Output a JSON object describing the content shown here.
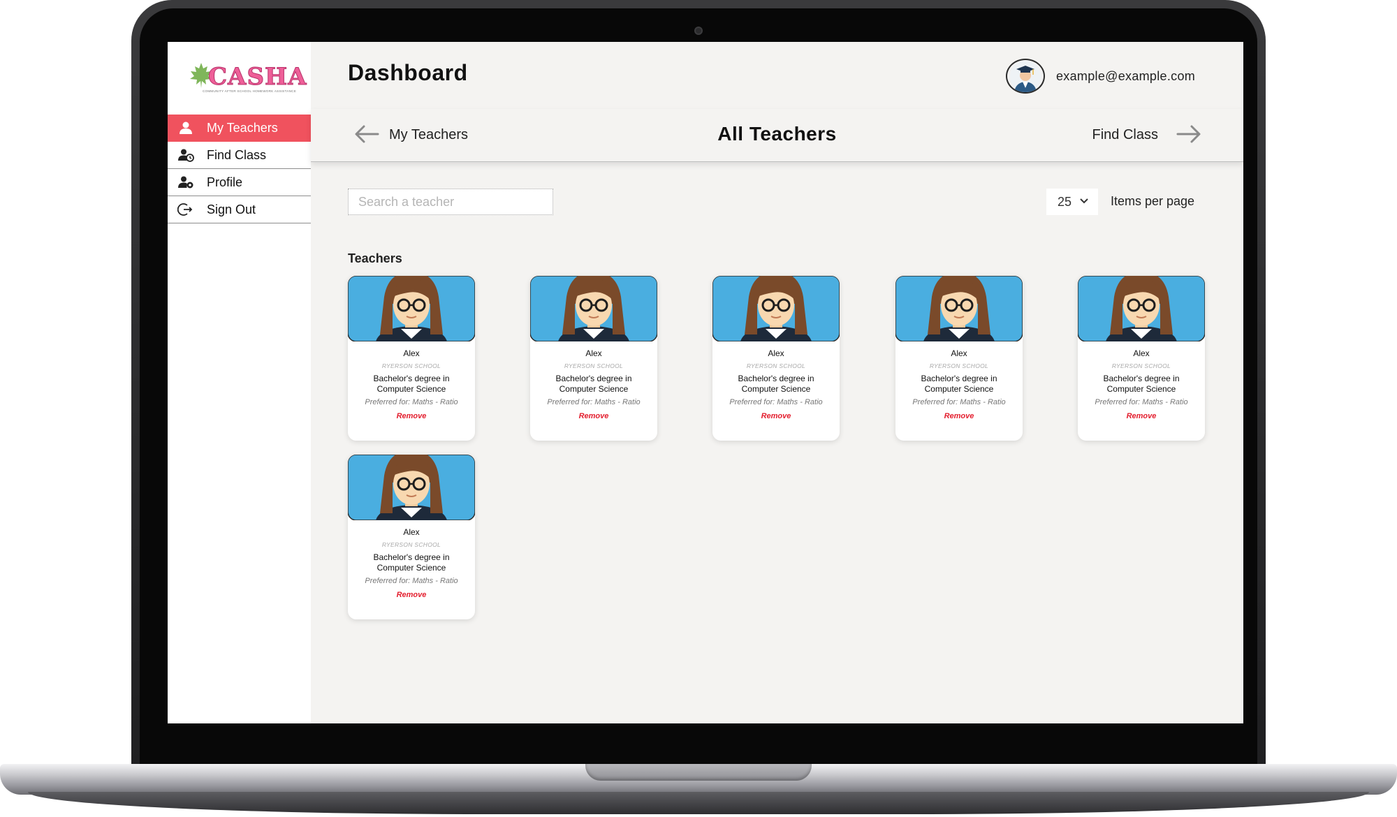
{
  "app": {
    "logo_text": "CASHA",
    "logo_subtitle": "COMMUNITY AFTER SCHOOL HOMEWORK ASSISTANCE",
    "accent_color": "#f0525e"
  },
  "sidebar": {
    "items": [
      {
        "label": "My Teachers",
        "icon": "user-icon",
        "active": true
      },
      {
        "label": "Find Class",
        "icon": "user-clock-icon",
        "active": false
      },
      {
        "label": "Profile",
        "icon": "user-gear-icon",
        "active": false
      },
      {
        "label": "Sign Out",
        "icon": "sign-out-icon",
        "active": false
      }
    ]
  },
  "header": {
    "title": "Dashboard",
    "user_email": "example@example.com"
  },
  "subheader": {
    "back_label": "My Teachers",
    "title": "All Teachers",
    "next_label": "Find Class"
  },
  "controls": {
    "search_placeholder": "Search a teacher",
    "items_per_page_value": "25",
    "items_per_page_label": "Items per page"
  },
  "section": {
    "label": "Teachers"
  },
  "teachers": [
    {
      "name": "Alex",
      "school": "RYERSON SCHOOL",
      "degree": "Bachelor's degree in Computer Science",
      "preferred": "Preferred for: Maths - Ratio",
      "action": "Remove"
    },
    {
      "name": "Alex",
      "school": "RYERSON SCHOOL",
      "degree": "Bachelor's degree in Computer Science",
      "preferred": "Preferred for: Maths - Ratio",
      "action": "Remove"
    },
    {
      "name": "Alex",
      "school": "RYERSON SCHOOL",
      "degree": "Bachelor's degree in Computer Science",
      "preferred": "Preferred for: Maths - Ratio",
      "action": "Remove"
    },
    {
      "name": "Alex",
      "school": "RYERSON SCHOOL",
      "degree": "Bachelor's degree in Computer Science",
      "preferred": "Preferred for: Maths - Ratio",
      "action": "Remove"
    },
    {
      "name": "Alex",
      "school": "RYERSON SCHOOL",
      "degree": "Bachelor's degree in Computer Science",
      "preferred": "Preferred for: Maths - Ratio",
      "action": "Remove"
    },
    {
      "name": "Alex",
      "school": "RYERSON SCHOOL",
      "degree": "Bachelor's degree in Computer Science",
      "preferred": "Preferred for: Maths - Ratio",
      "action": "Remove"
    }
  ]
}
